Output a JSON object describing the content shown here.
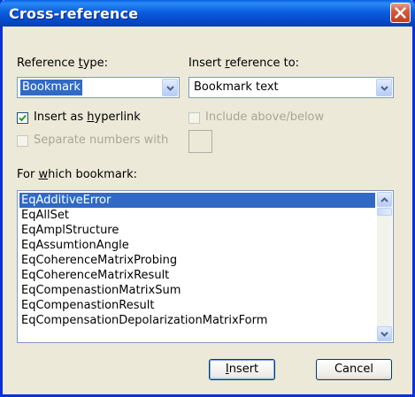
{
  "window": {
    "title": "Cross-reference"
  },
  "reference_type": {
    "label_before": "Reference ",
    "label_accel": "t",
    "label_after": "ype:",
    "value": "Bookmark"
  },
  "insert_reference": {
    "label_before": "Insert ",
    "label_accel": "r",
    "label_after": "eference to:",
    "value": "Bookmark text"
  },
  "insert_hyperlink": {
    "label_before": "Insert as ",
    "label_accel": "h",
    "label_after": "yperlink",
    "checked": true
  },
  "include_above_below": {
    "label": "Include above/below",
    "checked": false,
    "enabled": false
  },
  "separate_numbers": {
    "label": "Separate numbers with",
    "checked": false,
    "enabled": false,
    "value": ""
  },
  "bookmark_list": {
    "label_before": "For ",
    "label_accel": "w",
    "label_after": "hich bookmark:",
    "selected_index": 0,
    "items": [
      "EqAdditiveError",
      "EqAllSet",
      "EqAmplStructure",
      "EqAssumtionAngle",
      "EqCoherenceMatrixProbing",
      "EqCoherenceMatrixResult",
      "EqCompenastionMatrixSum",
      "EqCompenastionResult",
      "EqCompensationDepolarizationMatrixForm"
    ]
  },
  "buttons": {
    "insert_accel": "I",
    "insert_rest": "nsert",
    "cancel": "Cancel"
  },
  "colors": {
    "title_bar": "#0a5ee0",
    "selection": "#316ac5",
    "dialog_bg": "#ece9d8",
    "close_button": "#d65a3a"
  }
}
